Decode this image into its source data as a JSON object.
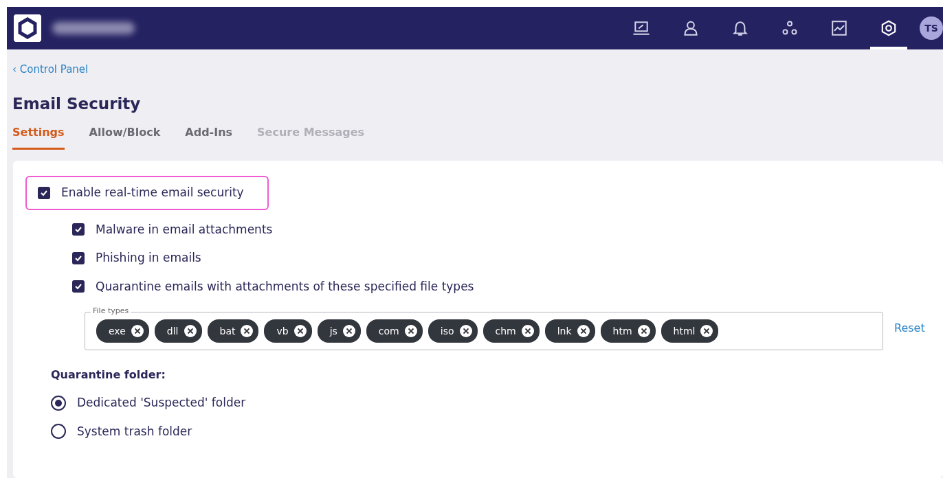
{
  "header": {
    "nav": [
      {
        "kind": "laptop",
        "selected": false
      },
      {
        "kind": "user",
        "selected": false
      },
      {
        "kind": "bell",
        "selected": false
      },
      {
        "kind": "nodes",
        "selected": false
      },
      {
        "kind": "chart",
        "selected": false
      },
      {
        "kind": "settings",
        "selected": true
      }
    ],
    "avatar": "TS"
  },
  "breadcrumb": {
    "caret": "‹",
    "label": "Control Panel"
  },
  "title": "Email Security",
  "tabs": [
    {
      "label": "Settings",
      "selected": true,
      "disabled": false
    },
    {
      "label": "Allow/Block",
      "selected": false,
      "disabled": false
    },
    {
      "label": "Add-Ins",
      "selected": false,
      "disabled": false
    },
    {
      "label": "Secure Messages",
      "selected": false,
      "disabled": true
    }
  ],
  "main_option": {
    "label": "Enable real-time email security",
    "checked": true,
    "highlighted": true
  },
  "sub_options": [
    {
      "label": "Malware in email attachments",
      "checked": true
    },
    {
      "label": "Phishing in emails",
      "checked": true
    },
    {
      "label": "Quarantine emails with attachments of these specified file types",
      "checked": true
    }
  ],
  "file_types": {
    "legend": "File types",
    "tags": [
      "exe",
      "dll",
      "bat",
      "vb",
      "js",
      "com",
      "iso",
      "chm",
      "lnk",
      "htm",
      "html"
    ],
    "reset": "Reset"
  },
  "quarantine": {
    "heading": "Quarantine folder:",
    "options": [
      {
        "label": "Dedicated 'Suspected' folder",
        "selected": true
      },
      {
        "label": "System trash folder",
        "selected": false
      }
    ]
  }
}
